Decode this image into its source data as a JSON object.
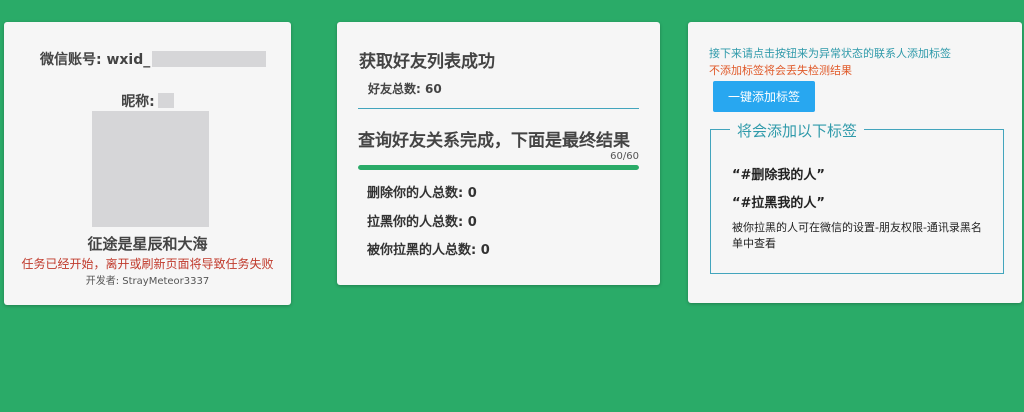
{
  "profile": {
    "account_label": "微信账号: wxid_",
    "nickname_label": "昵称:",
    "motto": "征途是星辰和大海",
    "warning": "任务已经开始，离开或刷新页面将导致任务失败",
    "developer": "开发者: StrayMeteor3337"
  },
  "results": {
    "fetch_title": "获取好友列表成功",
    "friend_total": "好友总数: 60",
    "query_title": "查询好友关系完成，下面是最终结果",
    "progress_text": "60/60",
    "progress_fraction": 1.0,
    "deleted_count": "删除你的人总数: 0",
    "blocked_count": "拉黑你的人总数: 0",
    "blocked_by_you_count": "被你拉黑的人总数: 0"
  },
  "tagging": {
    "instruction": "接下来请点击按钮来为异常状态的联系人添加标签",
    "caution": "不添加标签将会丢失检测结果",
    "button_label": "一键添加标签",
    "legend": "将会添加以下标签",
    "tags": [
      "“#删除我的人”",
      "“#拉黑我的人”"
    ],
    "note": "被你拉黑的人可在微信的设置-朋友权限-通讯录黑名单中查看"
  },
  "colors": {
    "background": "#2aab68",
    "accent_teal": "#2f9aaa",
    "warning_red": "#c0392b",
    "caution_orange": "#e05a2a",
    "button_blue": "#28a7f0",
    "progress": "#2aab68"
  }
}
